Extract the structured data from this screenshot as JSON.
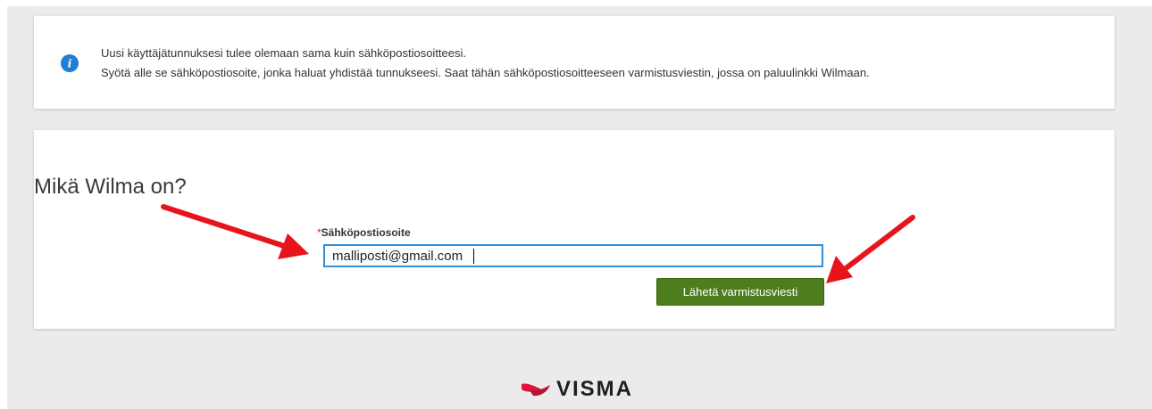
{
  "info": {
    "line1": "Uusi käyttäjätunnuksesi tulee olemaan sama kuin sähköpostiosoitteesi.",
    "line2": "Syötä alle se sähköpostiosoite, jonka haluat yhdistää tunnukseesi. Saat tähän sähköpostiosoitteeseen varmistusviestin, jossa on paluulinkki Wilmaan.",
    "icon": "info-icon"
  },
  "form": {
    "title": "Mikä Wilma on?",
    "required_marker": "*",
    "email_label": "Sähköpostiosoite",
    "email_value": "malliposti@gmail.com",
    "submit_label": "Lähetä varmistusviesti"
  },
  "footer": {
    "logo_text": "VISMA"
  },
  "colors": {
    "accent_blue": "#2e8fd8",
    "button_green": "#4e7d1d",
    "annotation_red": "#e8141b"
  }
}
